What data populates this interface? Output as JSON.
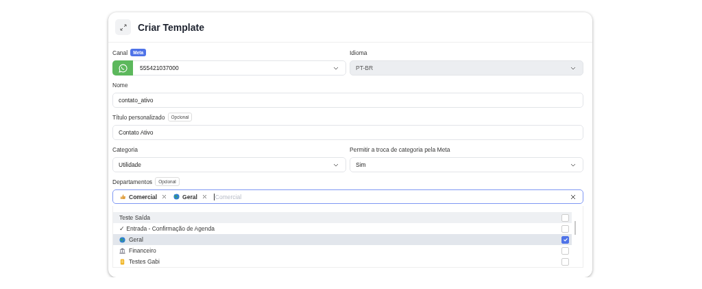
{
  "window": {
    "title": "Criar Template"
  },
  "fields": [
    {
      "kind": "channel",
      "label": "Canal",
      "badge": "Meta",
      "value": "555421037000"
    },
    {
      "kind": "select",
      "label": "Idioma",
      "value": "PT-BR",
      "disabled": true
    },
    {
      "kind": "input",
      "label": "Nome",
      "value": "contato_ativo"
    },
    {
      "kind": "input",
      "label": "Título personalizado",
      "badge": "Opcional",
      "value": "Contato Ativo"
    },
    {
      "kind": "select",
      "label": "Categoria",
      "value": "Utilidade",
      "disabled": false
    },
    {
      "kind": "select",
      "label": "Permitir a troca de categoria pela Meta",
      "value": "Sim",
      "disabled": false
    }
  ],
  "departments": {
    "label": "Departamentos",
    "badge": "Opcional",
    "tags": [
      {
        "label": "Comercial"
      },
      {
        "label": "Geral"
      }
    ],
    "placeholder": "Comercial",
    "options": [
      {
        "label": "Teste Saída",
        "checked": false,
        "highlighted": true
      },
      {
        "label": "✓ Entrada - Confirmação de Agenda",
        "checked": false,
        "highlighted": false
      },
      {
        "label": "Geral",
        "checked": true,
        "highlighted": false
      },
      {
        "label": "Financeiro",
        "checked": false,
        "highlighted": false
      },
      {
        "label": "Testes Gabi",
        "checked": false,
        "highlighted": false
      }
    ]
  }
}
